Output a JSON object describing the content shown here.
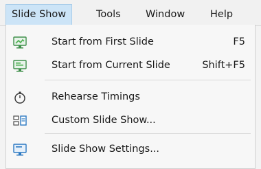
{
  "menubar": {
    "items": [
      {
        "label": "Slide Show"
      },
      {
        "label": "Tools"
      },
      {
        "label": "Window"
      },
      {
        "label": "Help"
      }
    ]
  },
  "dropdown": {
    "items": [
      {
        "label": "Start from First Slide",
        "shortcut": "F5",
        "icon": "presentation-start-icon"
      },
      {
        "label": "Start from Current Slide",
        "shortcut": "Shift+F5",
        "icon": "presentation-current-icon"
      },
      {
        "label": "Rehearse Timings",
        "icon": "stopwatch-icon"
      },
      {
        "label": "Custom Slide Show...",
        "icon": "custom-slideshow-icon"
      },
      {
        "label": "Slide Show Settings...",
        "icon": "slideshow-settings-icon"
      }
    ]
  },
  "colors": {
    "active_menu_bg": "#cce4f7",
    "icon_green": "#4caf50",
    "icon_blue": "#2b79c2"
  }
}
